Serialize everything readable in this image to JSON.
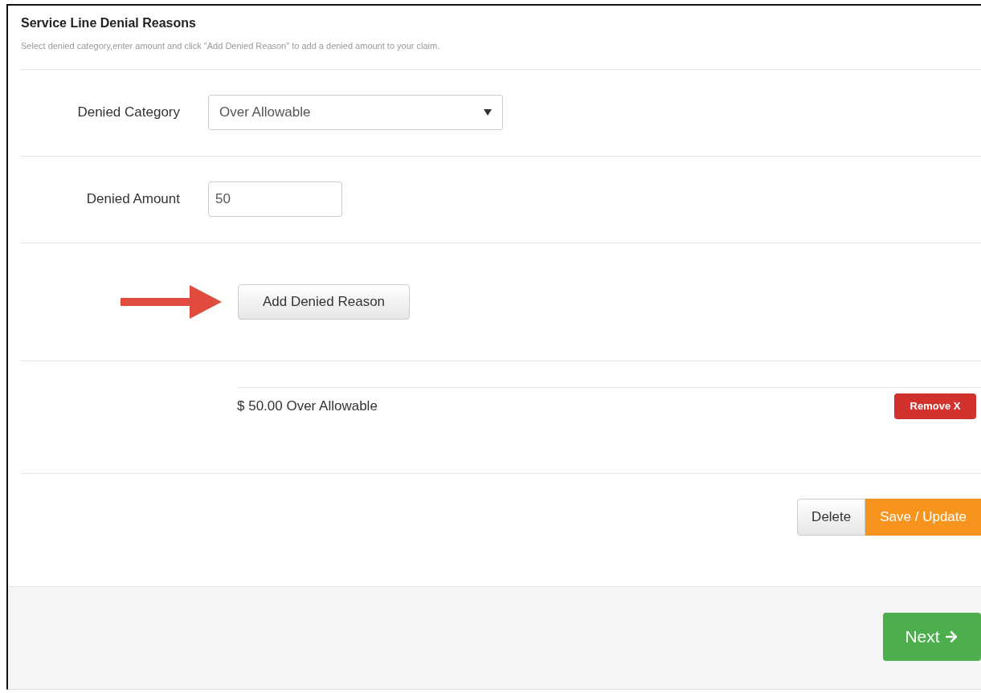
{
  "panel": {
    "title": "Service Line Denial Reasons",
    "description": "Select denied category,enter amount and click \"Add Denied Reason\" to add a denied amount to your claim."
  },
  "fields": [
    {
      "kind": "select",
      "label": "Denied Category",
      "value": "Over Allowable"
    },
    {
      "kind": "text",
      "label": "Denied Amount",
      "value": "50"
    }
  ],
  "add_button": "Add Denied Reason",
  "denied_reasons": [
    {
      "text": "$ 50.00 Over Allowable",
      "remove_button": "Remove X"
    }
  ],
  "actions": [
    "Delete",
    "Save / Update"
  ],
  "footer": {
    "next_button": "Next"
  }
}
